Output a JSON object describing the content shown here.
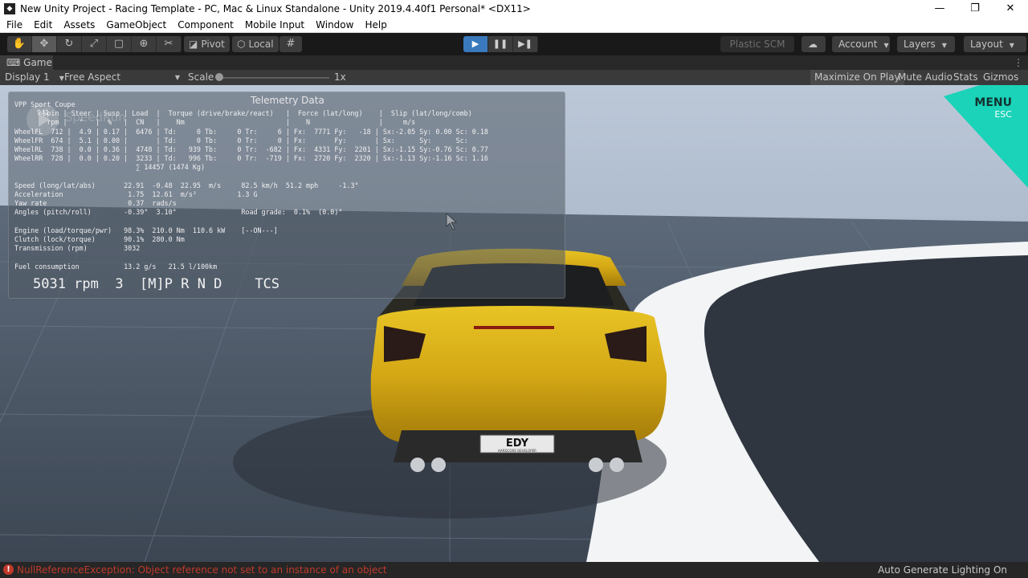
{
  "window": {
    "title": "New Unity Project - Racing Template - PC, Mac & Linux Standalone - Unity 2019.4.40f1 Personal* <DX11>",
    "minimize": "—",
    "maximize": "❐",
    "close": "✕"
  },
  "menu": [
    "File",
    "Edit",
    "Assets",
    "GameObject",
    "Component",
    "Mobile Input",
    "Window",
    "Help"
  ],
  "toolbar": {
    "tools": [
      "hand-tool",
      "move-tool",
      "rotate-tool",
      "scale-tool",
      "rect-tool",
      "transform-tool",
      "custom-tool"
    ],
    "pivot_label": "Pivot",
    "local_label": "Local",
    "plastic_label": "Plastic SCM",
    "account_label": "Account",
    "layers_label": "Layers",
    "layout_label": "Layout"
  },
  "game_tab": {
    "label": "Game",
    "display": "Display 1",
    "aspect": "Free Aspect",
    "scale_label": "Scale",
    "scale_value": "1x",
    "maximize_on_play": "Maximize On Play",
    "mute_audio": "Mute Audio",
    "stats": "Stats",
    "gizmos": "Gizmos"
  },
  "telemetry": {
    "title": "Telemetry Data",
    "watermark": "SpeedRun",
    "lines": [
      "VPP Sport Coupe",
      "       Spin | Steer | Susp | Load  |  Torque (drive/brake/react)   |  Force (lat/long)    |  Slip (lat/long/comb)",
      "        rpm |   °   |  %   |  CN   |    Nm                         |    N                 |     m/s",
      "WheelFL  712 |  4.9 | 0.17 |  6476 | Td:     0 Tb:     0 Tr:     6 | Fx:  7771 Fy:   -18 | Sx:-2.05 Sy: 0.00 Sc: 0.18",
      "WheelFR  674 |  5.1 | 0.00 |       | Td:     0 Tb:     0 Tr:     0 | Fx:       Fy:       | Sx:      Sy:      Sc:",
      "WheelRL  738 |  0.0 | 0.36 |  4748 | Td:   939 Tb:     0 Tr:  -682 | Fx:  4331 Fy:  2201 | Sx:-1.15 Sy:-0.76 Sc: 0.77",
      "WheelRR  728 |  0.0 | 0.20 |  3233 | Td:   996 Tb:     0 Tr:  -719 | Fx:  2720 Fy:  2320 | Sx:-1.13 Sy:-1.16 Sc: 1.16",
      "                              ∑ 14457 (1474 Kg)",
      "",
      "Speed (long/lat/abs)       22.91  -0.48  22.95  m/s     82.5 km/h  51.2 mph     -1.3°",
      "Acceleration                1.75  12.61  m/s²          1.3 G",
      "Yaw rate                    0.37  rads/s",
      "Angles (pitch/roll)        -0.39°  3.10°                Road grade:  0.1%  (0.0)°",
      "",
      "Engine (load/torque/pwr)   98.3%  210.0 Nm  110.6 kW    [--ON---]",
      "Clutch (lock/torque)       90.1%  280.0 Nm",
      "Transmission (rpm)         3032",
      "",
      "Fuel consumption           13.2 g/s   21.5 l/100km"
    ],
    "big_status": "5031 rpm  3  [M]P R N D    TCS",
    "extra_tick": "941"
  },
  "menu_corner": {
    "label": "MENU",
    "hint": "ESC"
  },
  "car": {
    "plate": "EDY",
    "plate_sub": "HARDCORE DEVELOPER"
  },
  "status": {
    "error": "NullReferenceException: Object reference not set to an instance of an object",
    "lighting": "Auto Generate Lighting On"
  },
  "colors": {
    "car_body": "#d8b21a",
    "menu_triangle": "#1ad3b8",
    "play_active": "#3a79bb",
    "error": "#c0392b"
  }
}
